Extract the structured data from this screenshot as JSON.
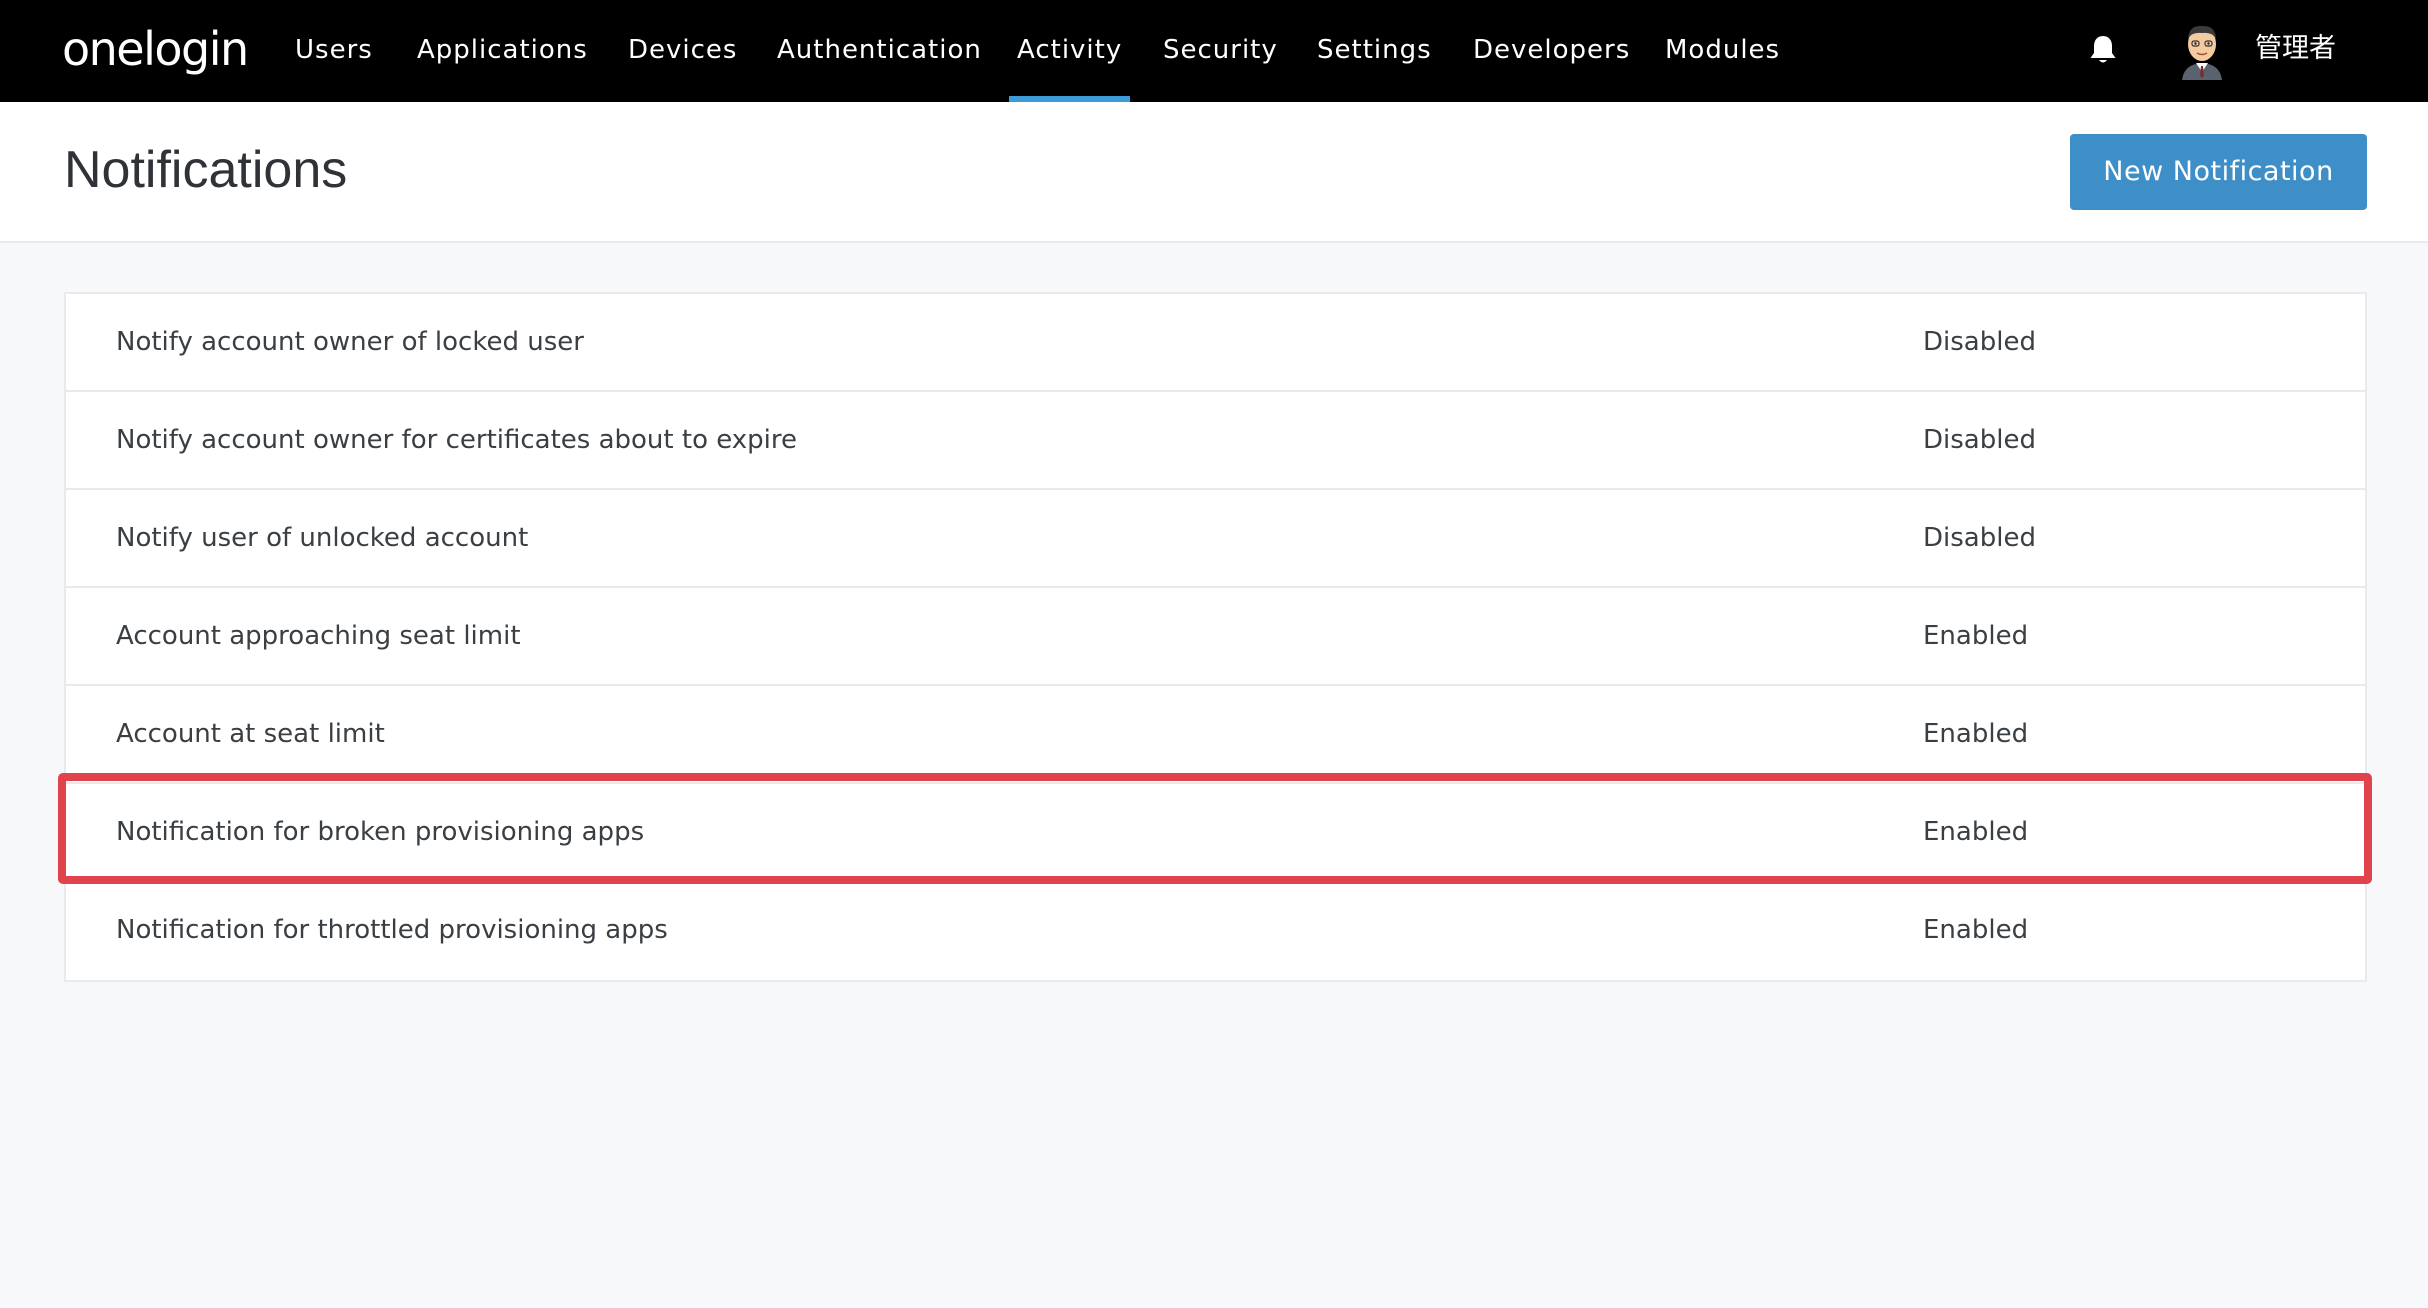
{
  "brand": {
    "logo_text": "onelogin"
  },
  "nav": {
    "items": [
      {
        "label": "Users",
        "active": false
      },
      {
        "label": "Applications",
        "active": false
      },
      {
        "label": "Devices",
        "active": false
      },
      {
        "label": "Authentication",
        "active": false
      },
      {
        "label": "Activity",
        "active": true
      },
      {
        "label": "Security",
        "active": false
      },
      {
        "label": "Settings",
        "active": false
      },
      {
        "label": "Developers",
        "active": false
      },
      {
        "label": "Modules",
        "active": false
      }
    ],
    "notifications_icon": "bell-icon",
    "user_avatar_icon": "avatar-icon",
    "user_name": "管理者"
  },
  "header": {
    "title": "Notifications",
    "new_button_label": "New Notification"
  },
  "notifications": [
    {
      "name": "Notify account owner of locked user",
      "status": "Disabled"
    },
    {
      "name": "Notify account owner for certificates about to expire",
      "status": "Disabled"
    },
    {
      "name": "Notify user of unlocked account",
      "status": "Disabled"
    },
    {
      "name": "Account approaching seat limit",
      "status": "Enabled"
    },
    {
      "name": "Account at seat limit",
      "status": "Enabled"
    },
    {
      "name": "Notification for broken provisioning apps",
      "status": "Enabled"
    },
    {
      "name": "Notification for throttled provisioning apps",
      "status": "Enabled"
    }
  ],
  "colors": {
    "topbar": "#000000",
    "accent": "#3d9bd8",
    "button": "#3e8ec7",
    "highlight": "#e0434b"
  }
}
